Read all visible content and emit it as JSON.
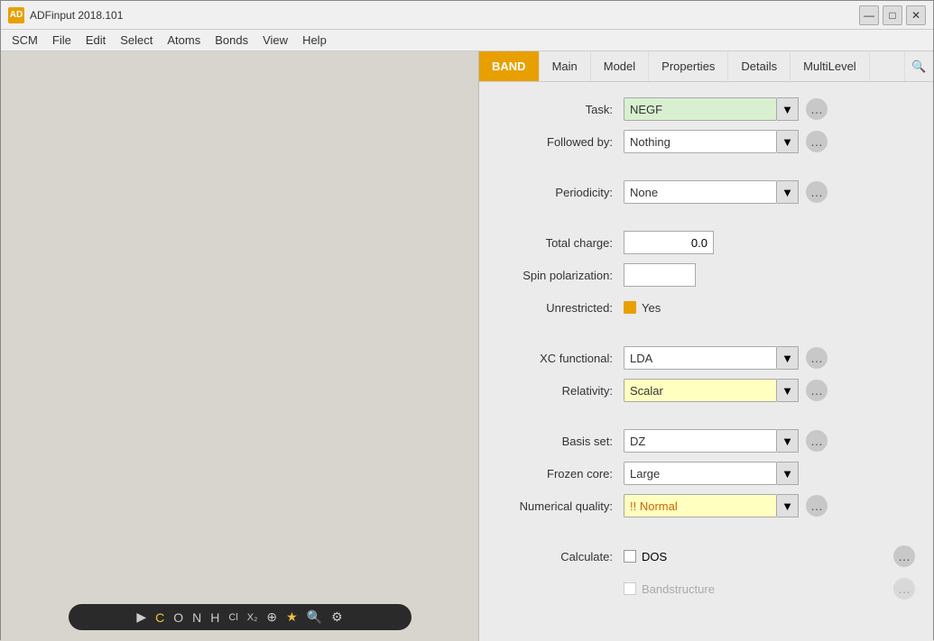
{
  "app": {
    "title": "ADFinput 2018.101",
    "icon_label": "AD"
  },
  "title_controls": {
    "minimize": "—",
    "maximize": "□",
    "close": "✕"
  },
  "menu": {
    "items": [
      "SCM",
      "File",
      "Edit",
      "Select",
      "Atoms",
      "Bonds",
      "View",
      "Help"
    ]
  },
  "tabs": {
    "items": [
      {
        "label": "BAND",
        "active": true
      },
      {
        "label": "Main",
        "active": false
      },
      {
        "label": "Model",
        "active": false
      },
      {
        "label": "Properties",
        "active": false
      },
      {
        "label": "Details",
        "active": false
      },
      {
        "label": "MultiLevel",
        "active": false
      }
    ]
  },
  "form": {
    "task_label": "Task:",
    "task_value": "NEGF",
    "task_dropdown_arrow": "▼",
    "followed_by_label": "Followed by:",
    "followed_by_value": "Nothing",
    "followed_by_arrow": "▼",
    "periodicity_label": "Periodicity:",
    "periodicity_value": "None",
    "periodicity_arrow": "▼",
    "total_charge_label": "Total charge:",
    "total_charge_value": "0.0",
    "spin_polarization_label": "Spin polarization:",
    "spin_polarization_value": "",
    "unrestricted_label": "Unrestricted:",
    "unrestricted_value": "Yes",
    "xc_functional_label": "XC functional:",
    "xc_functional_value": "LDA",
    "xc_functional_arrow": "▼",
    "relativity_label": "Relativity:",
    "relativity_value": "Scalar",
    "relativity_arrow": "▼",
    "basis_set_label": "Basis set:",
    "basis_set_value": "DZ",
    "basis_set_arrow": "▼",
    "frozen_core_label": "Frozen core:",
    "frozen_core_value": "Large",
    "frozen_core_arrow": "▼",
    "numerical_quality_label": "Numerical quality:",
    "numerical_quality_value": "!! Normal",
    "numerical_quality_arrow": "▼",
    "calculate_label": "Calculate:",
    "calculate_dos": "DOS",
    "calculate_bandstructure": "Bandstructure"
  },
  "toolbar": {
    "icons": [
      "▶",
      "C",
      "O",
      "N",
      "H",
      "Cl",
      "X₂",
      "⊕",
      "★",
      "🔍",
      "⚙"
    ]
  },
  "colors": {
    "band_tab": "#e8a000",
    "green_input": "#d8f0d0",
    "yellow_input": "#ffffc0",
    "more_btn": "#c8c8c8"
  }
}
